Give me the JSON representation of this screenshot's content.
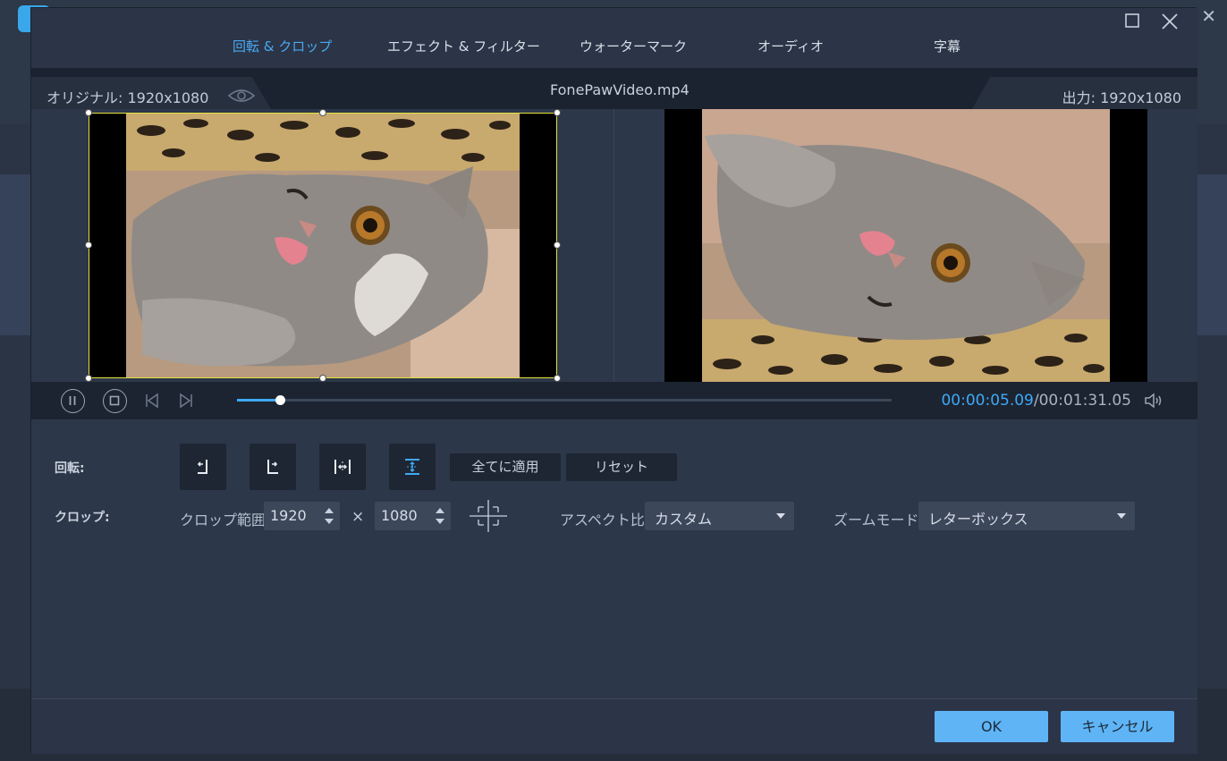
{
  "tabs": [
    {
      "label": "回転 & クロップ",
      "active": true
    },
    {
      "label": "エフェクト & フィルター",
      "active": false
    },
    {
      "label": "ウォーターマーク",
      "active": false
    },
    {
      "label": "オーディオ",
      "active": false
    },
    {
      "label": "字幕",
      "active": false
    }
  ],
  "preview": {
    "original_label": "オリジナル: 1920x1080",
    "output_label": "出力: 1920x1080",
    "file_name": "FonePawVideo.mp4"
  },
  "player": {
    "current_time": "00:00:05.09",
    "total_time": "/00:01:31.05",
    "progress": 0.065
  },
  "rotation": {
    "label": "回転:",
    "apply_all": "全てに適用",
    "reset": "リセット"
  },
  "crop": {
    "label": "クロップ:",
    "range_label": "クロップ範囲:",
    "width": "1920",
    "height": "1080",
    "times": "×",
    "aspect_label": "アスペクト比:",
    "aspect_value": "カスタム",
    "zoom_label": "ズームモード:",
    "zoom_value": "レターボックス"
  },
  "footer": {
    "ok": "OK",
    "cancel": "キャンセル"
  },
  "colors": {
    "accent": "#3fa9f5",
    "crop_border": "#e6e23a",
    "primary_button": "#5fb4f5"
  }
}
